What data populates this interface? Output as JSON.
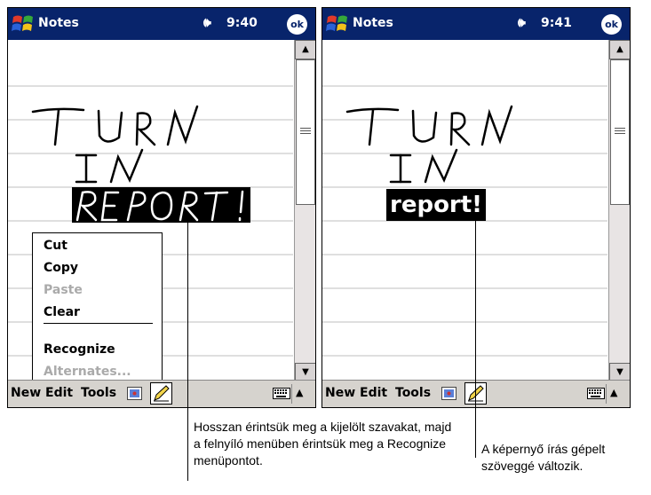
{
  "screens": [
    {
      "title": "Notes",
      "time": "9:40",
      "ok_label": "ok",
      "handwriting": [
        "TURN",
        "IN"
      ],
      "selected_word": "REPORT!",
      "menu": [
        "New",
        "Edit",
        "Tools"
      ],
      "context_menu": {
        "items": [
          {
            "label": "Cut",
            "enabled": true
          },
          {
            "label": "Copy",
            "enabled": true
          },
          {
            "label": "Paste",
            "enabled": false
          },
          {
            "label": "Clear",
            "enabled": true
          },
          {
            "label": "Recognize",
            "enabled": true
          },
          {
            "label": "Alternates...",
            "enabled": false
          }
        ]
      }
    },
    {
      "title": "Notes",
      "time": "9:41",
      "ok_label": "ok",
      "handwriting": [
        "TURN",
        "IN"
      ],
      "typed_word": "report!",
      "menu": [
        "New",
        "Edit",
        "Tools"
      ]
    }
  ],
  "callouts": [
    "Hosszan érintsük meg a kijelölt szavakat, majd a felnyíló menüben érintsük meg a Recognize menüpontot.",
    "A képernyő írás gépelt szöveggé változik."
  ],
  "colors": {
    "titlebar": "#08246b",
    "menubar": "#d6d3ce",
    "selection": "#000000"
  },
  "icons": [
    "windows-start-icon",
    "speaker-icon",
    "ok-icon",
    "scroll-up-icon",
    "scroll-down-icon",
    "recording-icon",
    "pen-icon",
    "keyboard-icon",
    "sip-arrow-icon"
  ]
}
